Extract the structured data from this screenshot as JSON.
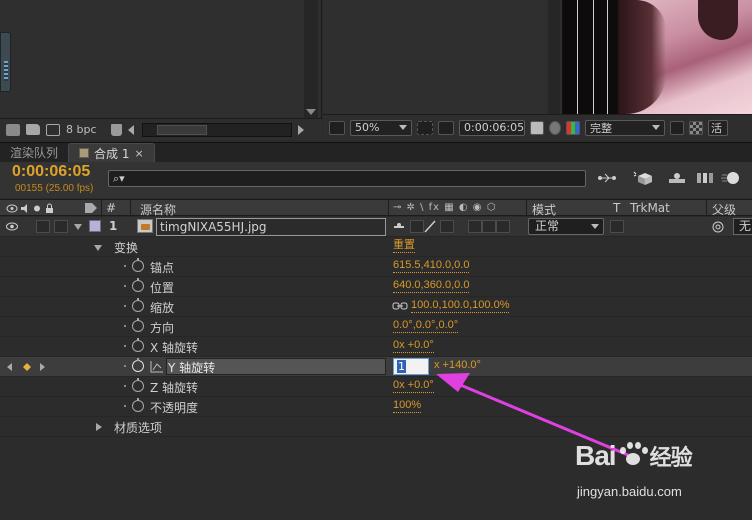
{
  "project_panel": {
    "bpc": "8 bpc"
  },
  "viewer": {
    "zoom": "50%",
    "timecode": "0:00:06:05",
    "resolution": "完整",
    "trailing_text": "活"
  },
  "tabs": [
    {
      "label": "渲染队列",
      "active": false
    },
    {
      "label": "合成 1",
      "active": true,
      "close": "×"
    }
  ],
  "timeline": {
    "timecode": "0:00:06:05",
    "fps": "00155 (25.00 fps)",
    "search_placeholder": "",
    "search_icon_glyph": "⌕▾"
  },
  "columns": {
    "number": "#",
    "source_name": "源名称",
    "mode": "模式",
    "t": "T",
    "trkmat": "TrkMat",
    "parent": "父级",
    "switches_glyphs": "⊸ ✲ \\ fx ▦ ◐ ◉ ⬡"
  },
  "layer": {
    "number": "1",
    "source_name": "timgNIXA55HJ.jpg",
    "mode": "正常",
    "parent": "无",
    "label_color": "#b7b3d8"
  },
  "properties": {
    "transform": {
      "label": "变换",
      "reset": "重置"
    },
    "anchor": {
      "label": "锚点",
      "value": "615.5,410.0,0.0"
    },
    "position": {
      "label": "位置",
      "value": "640.0,360.0,0.0"
    },
    "scale": {
      "label": "缩放",
      "value": "100.0,100.0,100.0%"
    },
    "orientation": {
      "label": "方向",
      "value": "0.0°,0.0°,0.0°"
    },
    "x_rotation": {
      "label": "X 轴旋转",
      "value": "0x +0.0°"
    },
    "y_rotation": {
      "label": "Y 轴旋转",
      "edit_value": "1",
      "suffix": "x +140.0°"
    },
    "z_rotation": {
      "label": "Z 轴旋转",
      "value": "0x +0.0°"
    },
    "opacity": {
      "label": "不透明度",
      "value": "100%"
    },
    "material": {
      "label": "材质选项"
    }
  },
  "watermark": {
    "brand": "Bai",
    "brand2": "经验",
    "url": "jingyan.baidu.com"
  },
  "colors": {
    "timecode": "#e0a32a",
    "property_value": "#d89a2a",
    "annotation_arrow": "#e040e0",
    "selection": "#2f63b8"
  }
}
